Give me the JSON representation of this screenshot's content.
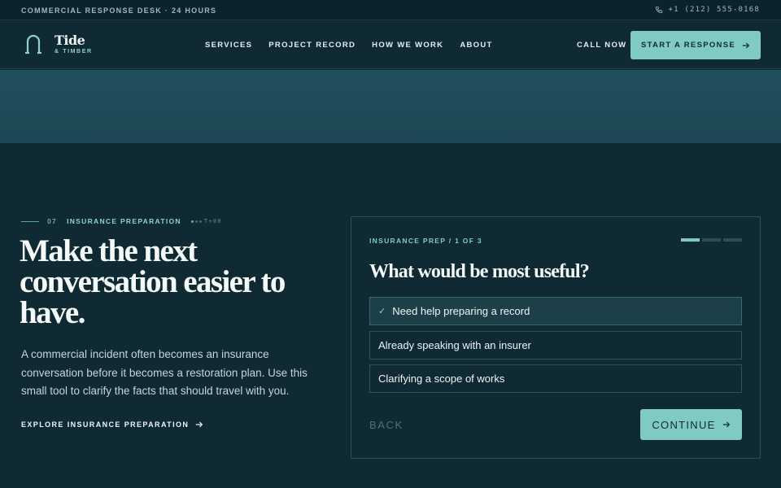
{
  "topbar": {
    "left": "COMMERCIAL RESPONSE DESK · 24 HOURS",
    "phone": "+1 (212) 555-0168",
    "phone_icon": "phone-icon"
  },
  "brand": {
    "name": "Tide",
    "sub": "& TIMBER",
    "icon": "arch-logo-icon"
  },
  "nav": {
    "items": [
      {
        "label": "SERVICES"
      },
      {
        "label": "PROJECT RECORD"
      },
      {
        "label": "HOW WE WORK"
      },
      {
        "label": "ABOUT"
      }
    ],
    "call": "CALL NOW",
    "cta": "START A RESPONSE"
  },
  "section": {
    "number": "07",
    "label": "INSURANCE PREPARATION",
    "timecode": "T+00",
    "headline": "Make the next conversation easier to have.",
    "lead": "A commercial incident often becomes an insurance conversation before it becomes a restoration plan. Use this small tool to clarify the facts that should travel with you.",
    "link": "EXPLORE INSURANCE PREPARATION"
  },
  "tool": {
    "step": "INSURANCE PREP / 1 OF 3",
    "progress": {
      "current": 1,
      "total": 3
    },
    "question": "What would be most useful?",
    "options": [
      {
        "label": "Need help preparing a record",
        "selected": true
      },
      {
        "label": "Already speaking with an insurer",
        "selected": false
      },
      {
        "label": "Clarifying a scope of works",
        "selected": false
      }
    ],
    "back": "BACK",
    "continue": "CONTINUE"
  },
  "colors": {
    "accent": "#7fcbc2",
    "background": "#0f2a33",
    "band": "#20505c"
  }
}
